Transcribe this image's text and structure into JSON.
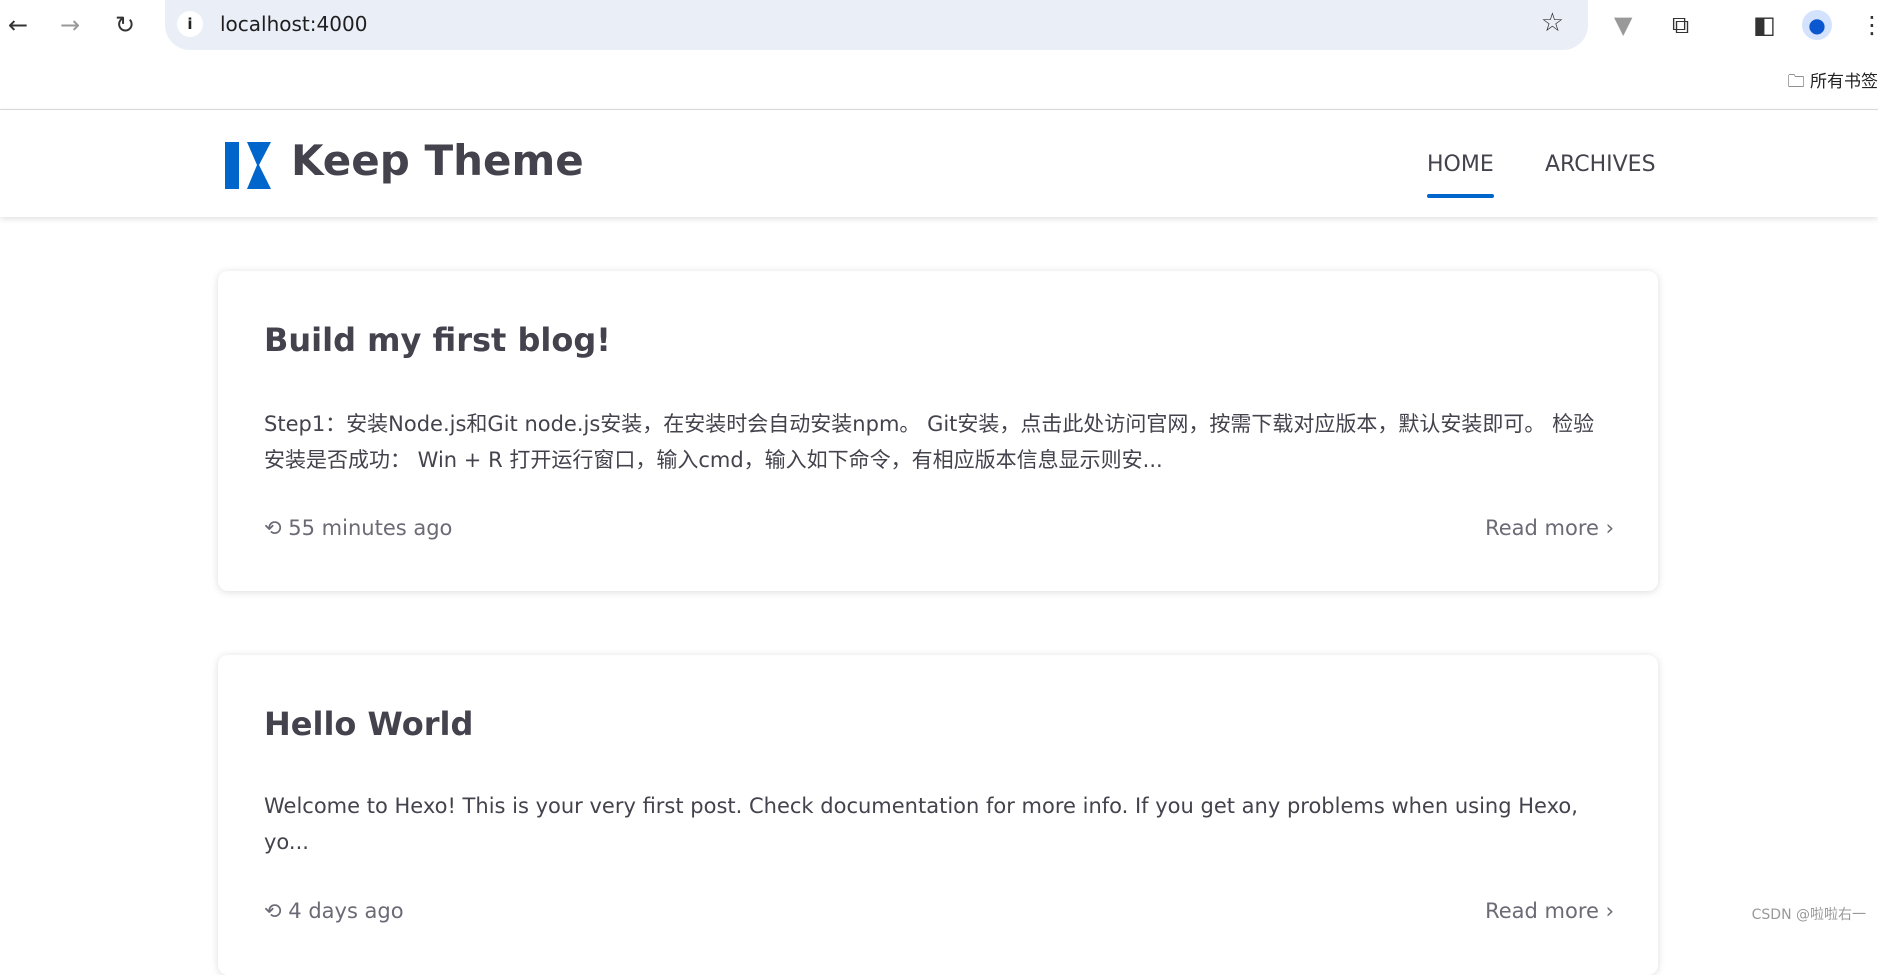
{
  "browser": {
    "url": "localhost:4000",
    "bookmarks_label": "所有书签"
  },
  "site": {
    "brand": "Keep Theme",
    "brand_color": "#0066cc",
    "nav": [
      {
        "label": "HOME",
        "active": true
      },
      {
        "label": "ARCHIVES",
        "active": false
      }
    ]
  },
  "posts": [
    {
      "title": "Build my first blog!",
      "excerpt": "Step1：安装Node.js和Git node.js安装，在安装时会自动安装npm。 Git安装，点击此处访问官网，按需下载对应版本，默认安装即可。 检验安装是否成功： Win + R 打开运行窗口，输入cmd，输入如下命令，有相应版本信息显示则安...",
      "time": "55 minutes ago",
      "read_more": "Read more"
    },
    {
      "title": "Hello World",
      "excerpt": "Welcome to Hexo! This is your very first post. Check documentation for more info. If you get any problems when using Hexo, yo...",
      "time": "4 days ago",
      "read_more": "Read more"
    }
  ],
  "watermark": "CSDN @啦啦右一"
}
